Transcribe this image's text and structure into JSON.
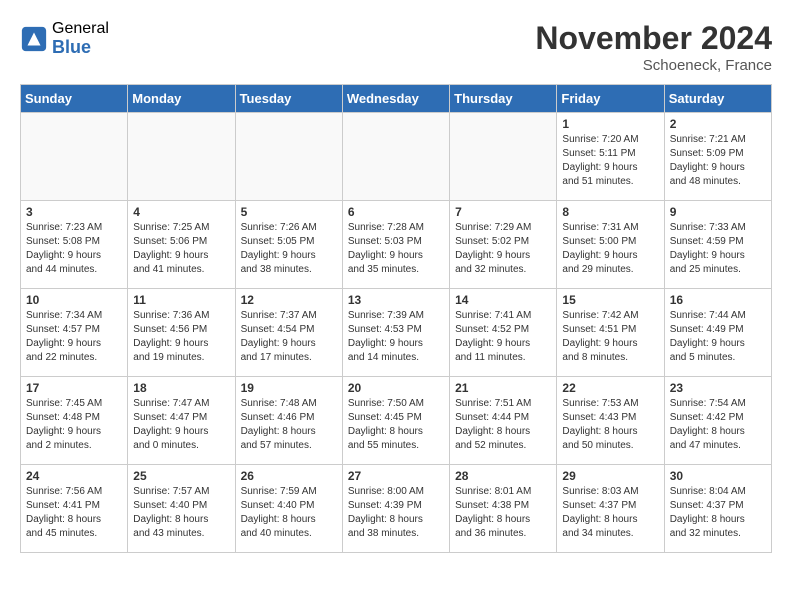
{
  "header": {
    "logo_general": "General",
    "logo_blue": "Blue",
    "month_title": "November 2024",
    "location": "Schoeneck, France"
  },
  "days_of_week": [
    "Sunday",
    "Monday",
    "Tuesday",
    "Wednesday",
    "Thursday",
    "Friday",
    "Saturday"
  ],
  "weeks": [
    [
      {
        "day": "",
        "info": ""
      },
      {
        "day": "",
        "info": ""
      },
      {
        "day": "",
        "info": ""
      },
      {
        "day": "",
        "info": ""
      },
      {
        "day": "",
        "info": ""
      },
      {
        "day": "1",
        "info": "Sunrise: 7:20 AM\nSunset: 5:11 PM\nDaylight: 9 hours\nand 51 minutes."
      },
      {
        "day": "2",
        "info": "Sunrise: 7:21 AM\nSunset: 5:09 PM\nDaylight: 9 hours\nand 48 minutes."
      }
    ],
    [
      {
        "day": "3",
        "info": "Sunrise: 7:23 AM\nSunset: 5:08 PM\nDaylight: 9 hours\nand 44 minutes."
      },
      {
        "day": "4",
        "info": "Sunrise: 7:25 AM\nSunset: 5:06 PM\nDaylight: 9 hours\nand 41 minutes."
      },
      {
        "day": "5",
        "info": "Sunrise: 7:26 AM\nSunset: 5:05 PM\nDaylight: 9 hours\nand 38 minutes."
      },
      {
        "day": "6",
        "info": "Sunrise: 7:28 AM\nSunset: 5:03 PM\nDaylight: 9 hours\nand 35 minutes."
      },
      {
        "day": "7",
        "info": "Sunrise: 7:29 AM\nSunset: 5:02 PM\nDaylight: 9 hours\nand 32 minutes."
      },
      {
        "day": "8",
        "info": "Sunrise: 7:31 AM\nSunset: 5:00 PM\nDaylight: 9 hours\nand 29 minutes."
      },
      {
        "day": "9",
        "info": "Sunrise: 7:33 AM\nSunset: 4:59 PM\nDaylight: 9 hours\nand 25 minutes."
      }
    ],
    [
      {
        "day": "10",
        "info": "Sunrise: 7:34 AM\nSunset: 4:57 PM\nDaylight: 9 hours\nand 22 minutes."
      },
      {
        "day": "11",
        "info": "Sunrise: 7:36 AM\nSunset: 4:56 PM\nDaylight: 9 hours\nand 19 minutes."
      },
      {
        "day": "12",
        "info": "Sunrise: 7:37 AM\nSunset: 4:54 PM\nDaylight: 9 hours\nand 17 minutes."
      },
      {
        "day": "13",
        "info": "Sunrise: 7:39 AM\nSunset: 4:53 PM\nDaylight: 9 hours\nand 14 minutes."
      },
      {
        "day": "14",
        "info": "Sunrise: 7:41 AM\nSunset: 4:52 PM\nDaylight: 9 hours\nand 11 minutes."
      },
      {
        "day": "15",
        "info": "Sunrise: 7:42 AM\nSunset: 4:51 PM\nDaylight: 9 hours\nand 8 minutes."
      },
      {
        "day": "16",
        "info": "Sunrise: 7:44 AM\nSunset: 4:49 PM\nDaylight: 9 hours\nand 5 minutes."
      }
    ],
    [
      {
        "day": "17",
        "info": "Sunrise: 7:45 AM\nSunset: 4:48 PM\nDaylight: 9 hours\nand 2 minutes."
      },
      {
        "day": "18",
        "info": "Sunrise: 7:47 AM\nSunset: 4:47 PM\nDaylight: 9 hours\nand 0 minutes."
      },
      {
        "day": "19",
        "info": "Sunrise: 7:48 AM\nSunset: 4:46 PM\nDaylight: 8 hours\nand 57 minutes."
      },
      {
        "day": "20",
        "info": "Sunrise: 7:50 AM\nSunset: 4:45 PM\nDaylight: 8 hours\nand 55 minutes."
      },
      {
        "day": "21",
        "info": "Sunrise: 7:51 AM\nSunset: 4:44 PM\nDaylight: 8 hours\nand 52 minutes."
      },
      {
        "day": "22",
        "info": "Sunrise: 7:53 AM\nSunset: 4:43 PM\nDaylight: 8 hours\nand 50 minutes."
      },
      {
        "day": "23",
        "info": "Sunrise: 7:54 AM\nSunset: 4:42 PM\nDaylight: 8 hours\nand 47 minutes."
      }
    ],
    [
      {
        "day": "24",
        "info": "Sunrise: 7:56 AM\nSunset: 4:41 PM\nDaylight: 8 hours\nand 45 minutes."
      },
      {
        "day": "25",
        "info": "Sunrise: 7:57 AM\nSunset: 4:40 PM\nDaylight: 8 hours\nand 43 minutes."
      },
      {
        "day": "26",
        "info": "Sunrise: 7:59 AM\nSunset: 4:40 PM\nDaylight: 8 hours\nand 40 minutes."
      },
      {
        "day": "27",
        "info": "Sunrise: 8:00 AM\nSunset: 4:39 PM\nDaylight: 8 hours\nand 38 minutes."
      },
      {
        "day": "28",
        "info": "Sunrise: 8:01 AM\nSunset: 4:38 PM\nDaylight: 8 hours\nand 36 minutes."
      },
      {
        "day": "29",
        "info": "Sunrise: 8:03 AM\nSunset: 4:37 PM\nDaylight: 8 hours\nand 34 minutes."
      },
      {
        "day": "30",
        "info": "Sunrise: 8:04 AM\nSunset: 4:37 PM\nDaylight: 8 hours\nand 32 minutes."
      }
    ]
  ]
}
